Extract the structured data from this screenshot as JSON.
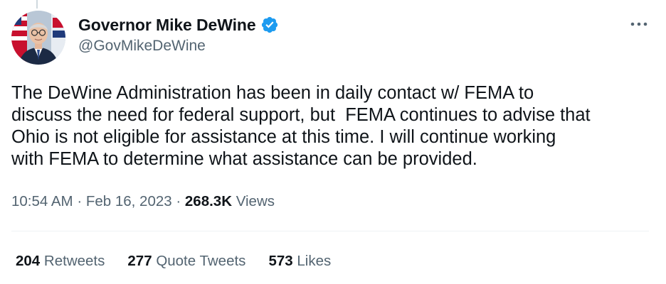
{
  "author": {
    "display_name": "Governor Mike DeWine",
    "handle": "@GovMikeDeWine",
    "verified": true
  },
  "tweet": {
    "text": "The DeWine Administration has been in daily contact w/ FEMA to\ndiscuss the need for federal support, but  FEMA continues to advise that\nOhio is not eligible for assistance at this time. I will continue working\nwith FEMA to determine what assistance can be provided."
  },
  "meta": {
    "time": "10:54 AM",
    "separator": " · ",
    "date": "Feb 16, 2023",
    "views_count": "268.3K",
    "views_label": "Views"
  },
  "stats": [
    {
      "count": "204",
      "label": "Retweets"
    },
    {
      "count": "277",
      "label": "Quote Tweets"
    },
    {
      "count": "573",
      "label": "Likes"
    }
  ],
  "icons": {
    "verified": "verified-badge-icon",
    "more": "more-options-icon"
  },
  "colors": {
    "primary_text": "#0f1419",
    "secondary_text": "#536471",
    "verified_blue": "#1d9bf0",
    "divider": "#eff3f4"
  }
}
